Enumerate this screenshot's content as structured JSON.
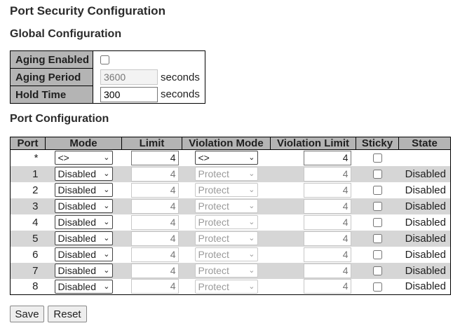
{
  "title": "Port Security Configuration",
  "global": {
    "heading": "Global Configuration",
    "aging_enabled_label": "Aging Enabled",
    "aging_period_label": "Aging Period",
    "aging_period_value": "3600",
    "aging_period_unit": "seconds",
    "hold_time_label": "Hold Time",
    "hold_time_value": "300",
    "hold_time_unit": "seconds"
  },
  "ports": {
    "heading": "Port Configuration",
    "columns": [
      "Port",
      "Mode",
      "Limit",
      "Violation Mode",
      "Violation Limit",
      "Sticky",
      "State"
    ],
    "wildcard": {
      "port": "*",
      "mode": "<>",
      "limit": "4",
      "violation_mode": "<>",
      "violation_limit": "4",
      "state": ""
    },
    "rows": [
      {
        "port": "1",
        "mode": "Disabled",
        "limit": "4",
        "violation_mode": "Protect",
        "violation_limit": "4",
        "state": "Disabled"
      },
      {
        "port": "2",
        "mode": "Disabled",
        "limit": "4",
        "violation_mode": "Protect",
        "violation_limit": "4",
        "state": "Disabled"
      },
      {
        "port": "3",
        "mode": "Disabled",
        "limit": "4",
        "violation_mode": "Protect",
        "violation_limit": "4",
        "state": "Disabled"
      },
      {
        "port": "4",
        "mode": "Disabled",
        "limit": "4",
        "violation_mode": "Protect",
        "violation_limit": "4",
        "state": "Disabled"
      },
      {
        "port": "5",
        "mode": "Disabled",
        "limit": "4",
        "violation_mode": "Protect",
        "violation_limit": "4",
        "state": "Disabled"
      },
      {
        "port": "6",
        "mode": "Disabled",
        "limit": "4",
        "violation_mode": "Protect",
        "violation_limit": "4",
        "state": "Disabled"
      },
      {
        "port": "7",
        "mode": "Disabled",
        "limit": "4",
        "violation_mode": "Protect",
        "violation_limit": "4",
        "state": "Disabled"
      },
      {
        "port": "8",
        "mode": "Disabled",
        "limit": "4",
        "violation_mode": "Protect",
        "violation_limit": "4",
        "state": "Disabled"
      }
    ]
  },
  "buttons": {
    "save": "Save",
    "reset": "Reset"
  },
  "colors": {
    "header_bg": "#b4b4b4",
    "row_alt_bg": "#d6d6d6"
  }
}
